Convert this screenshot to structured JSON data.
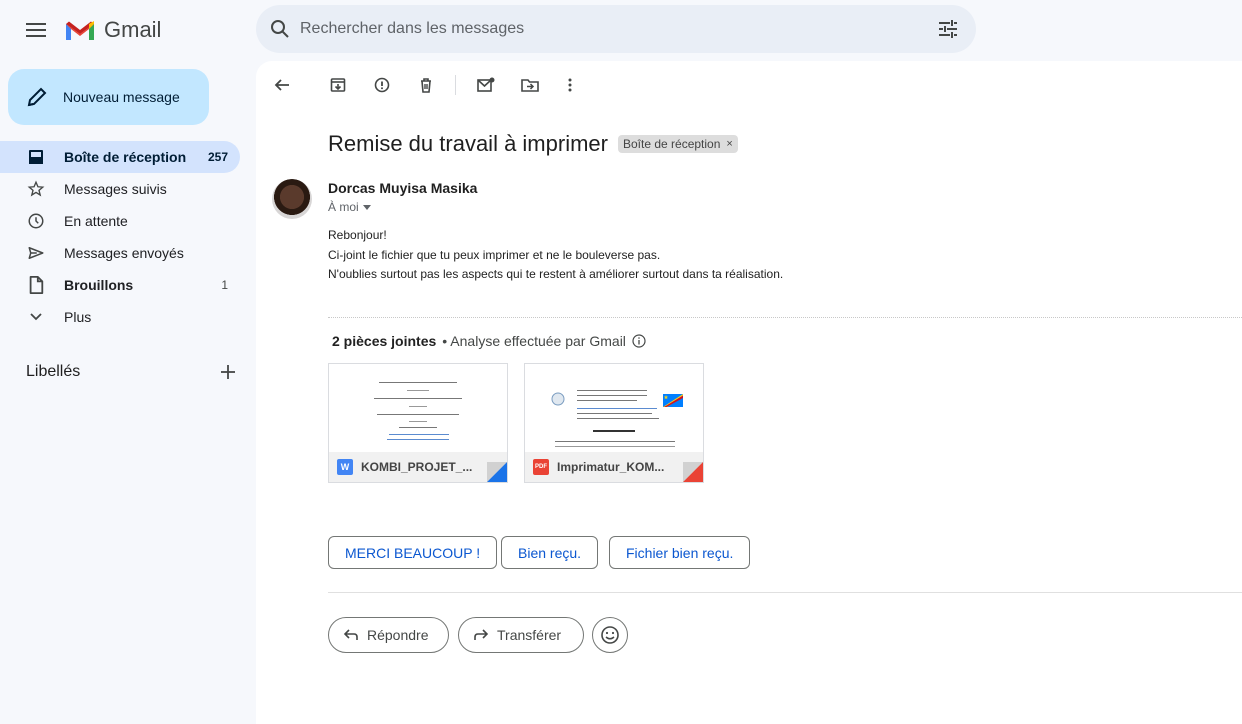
{
  "app": {
    "name": "Gmail"
  },
  "search": {
    "placeholder": "Rechercher dans les messages"
  },
  "sidebar": {
    "compose_label": "Nouveau message",
    "items": [
      {
        "label": "Boîte de réception",
        "count": "257",
        "icon": "inbox-icon"
      },
      {
        "label": "Messages suivis",
        "count": "",
        "icon": "star-icon"
      },
      {
        "label": "En attente",
        "count": "",
        "icon": "clock-icon"
      },
      {
        "label": "Messages envoyés",
        "count": "",
        "icon": "send-icon"
      },
      {
        "label": "Brouillons",
        "count": "1",
        "icon": "draft-icon"
      },
      {
        "label": "Plus",
        "count": "",
        "icon": "chevron-down-icon"
      }
    ],
    "labels_title": "Libellés"
  },
  "email": {
    "subject": "Remise du travail à imprimer",
    "label_chip": "Boîte de réception",
    "sender": "Dorcas Muyisa Masika",
    "to": "À moi",
    "body": [
      "Rebonjour!",
      "Ci-joint le fichier que tu peux imprimer et ne le bouleverse pas.",
      "N'oublies surtout pas les aspects qui te restent à améliorer surtout dans ta réalisation."
    ]
  },
  "attachments": {
    "count_label": "2 pièces jointes",
    "scan_label": "• Analyse effectuée par Gmail",
    "files": [
      {
        "name": "KOMBI_PROJET_...",
        "type": "W",
        "type_color": "#4285f4"
      },
      {
        "name": "Imprimatur_KOM...",
        "type": "PDF",
        "type_color": "#ea4335"
      }
    ]
  },
  "smart_replies": [
    "MERCI BEAUCOUP !",
    "Bien reçu.",
    "Fichier bien reçu."
  ],
  "actions": {
    "reply": "Répondre",
    "forward": "Transférer"
  },
  "colors": {
    "accent": "#0b57d0",
    "compose_bg": "#c2e7ff",
    "active_nav": "#d3e3fd"
  }
}
